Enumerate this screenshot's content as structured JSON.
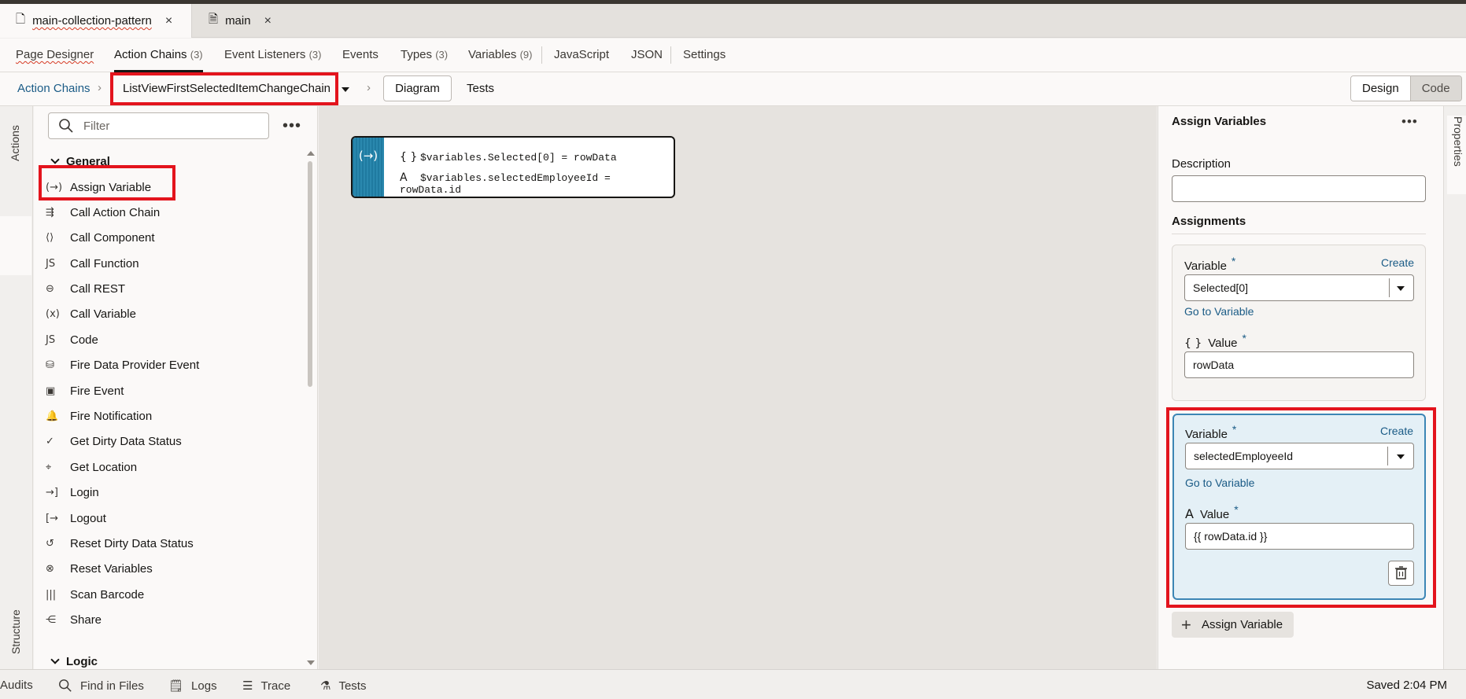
{
  "file_tabs": [
    {
      "label": "main-collection-pattern",
      "active": true
    },
    {
      "label": "main",
      "active": false
    }
  ],
  "nav_tabs": [
    {
      "label": "Page Designer",
      "count": ""
    },
    {
      "label": "Action Chains",
      "count": "(3)"
    },
    {
      "label": "Event Listeners",
      "count": "(3)"
    },
    {
      "label": "Events",
      "count": ""
    },
    {
      "label": "Types",
      "count": "(3)"
    },
    {
      "label": "Variables",
      "count": "(9)"
    },
    {
      "label": "JavaScript",
      "count": ""
    },
    {
      "label": "JSON",
      "count": ""
    },
    {
      "label": "Settings",
      "count": ""
    }
  ],
  "breadcrumb": {
    "root": "Action Chains",
    "chain": "ListViewFirstSelectedItemChangeChain",
    "diagram": "Diagram",
    "tests": "Tests"
  },
  "view_toggle": {
    "design": "Design",
    "code": "Code",
    "selected": "Code"
  },
  "side_tabs": {
    "actions": "Actions",
    "structure": "Structure",
    "properties": "Properties"
  },
  "palette": {
    "filter_placeholder": "Filter",
    "groups": [
      "General",
      "Logic"
    ],
    "items": [
      {
        "icon": "(→)",
        "label": "Assign Variable"
      },
      {
        "icon": "⇶",
        "label": "Call Action Chain"
      },
      {
        "icon": "⟨⟩",
        "label": "Call Component"
      },
      {
        "icon": "JS",
        "label": "Call Function"
      },
      {
        "icon": "⊖",
        "label": "Call REST"
      },
      {
        "icon": "(x)",
        "label": "Call Variable"
      },
      {
        "icon": "JS",
        "label": "Code"
      },
      {
        "icon": "⛁",
        "label": "Fire Data Provider Event"
      },
      {
        "icon": "▣",
        "label": "Fire Event"
      },
      {
        "icon": "🔔",
        "label": "Fire Notification"
      },
      {
        "icon": "✓",
        "label": "Get Dirty Data Status"
      },
      {
        "icon": "⌖",
        "label": "Get Location"
      },
      {
        "icon": "→]",
        "label": "Login"
      },
      {
        "icon": "[→",
        "label": "Logout"
      },
      {
        "icon": "↺",
        "label": "Reset Dirty Data Status"
      },
      {
        "icon": "⊗",
        "label": "Reset Variables"
      },
      {
        "icon": "|||",
        "label": "Scan Barcode"
      },
      {
        "icon": "⋲",
        "label": "Share"
      }
    ]
  },
  "diagram_node": {
    "icon": "(→)",
    "lines": [
      {
        "icon": "{ }",
        "text": "$variables.Selected[0] = rowData"
      },
      {
        "icon": "A",
        "text": "$variables.selectedEmployeeId = rowData.id"
      }
    ]
  },
  "properties": {
    "title": "Assign Variables",
    "description_label": "Description",
    "description_value": "",
    "assignments_label": "Assignments",
    "assignments": [
      {
        "variable_label": "Variable",
        "create": "Create",
        "variable": "Selected[0]",
        "goto": "Go to Variable",
        "value_icon": "{ }",
        "value_label": "Value",
        "value": "rowData"
      },
      {
        "variable_label": "Variable",
        "create": "Create",
        "variable": "selectedEmployeeId",
        "goto": "Go to Variable",
        "value_icon": "A",
        "value_label": "Value",
        "value": "{{ rowData.id }}"
      }
    ],
    "required_mark": "*",
    "add_button": "Assign Variable"
  },
  "status_bar": {
    "audits": "Audits",
    "find": "Find in Files",
    "logs": "Logs",
    "trace": "Trace",
    "tests": "Tests",
    "saved": "Saved 2:04 PM"
  },
  "colors": {
    "accent_link": "#1a5b86",
    "highlight_red": "#e3141d",
    "selected_card": "#e4f0f6",
    "node_side": "#1f7aa0"
  }
}
